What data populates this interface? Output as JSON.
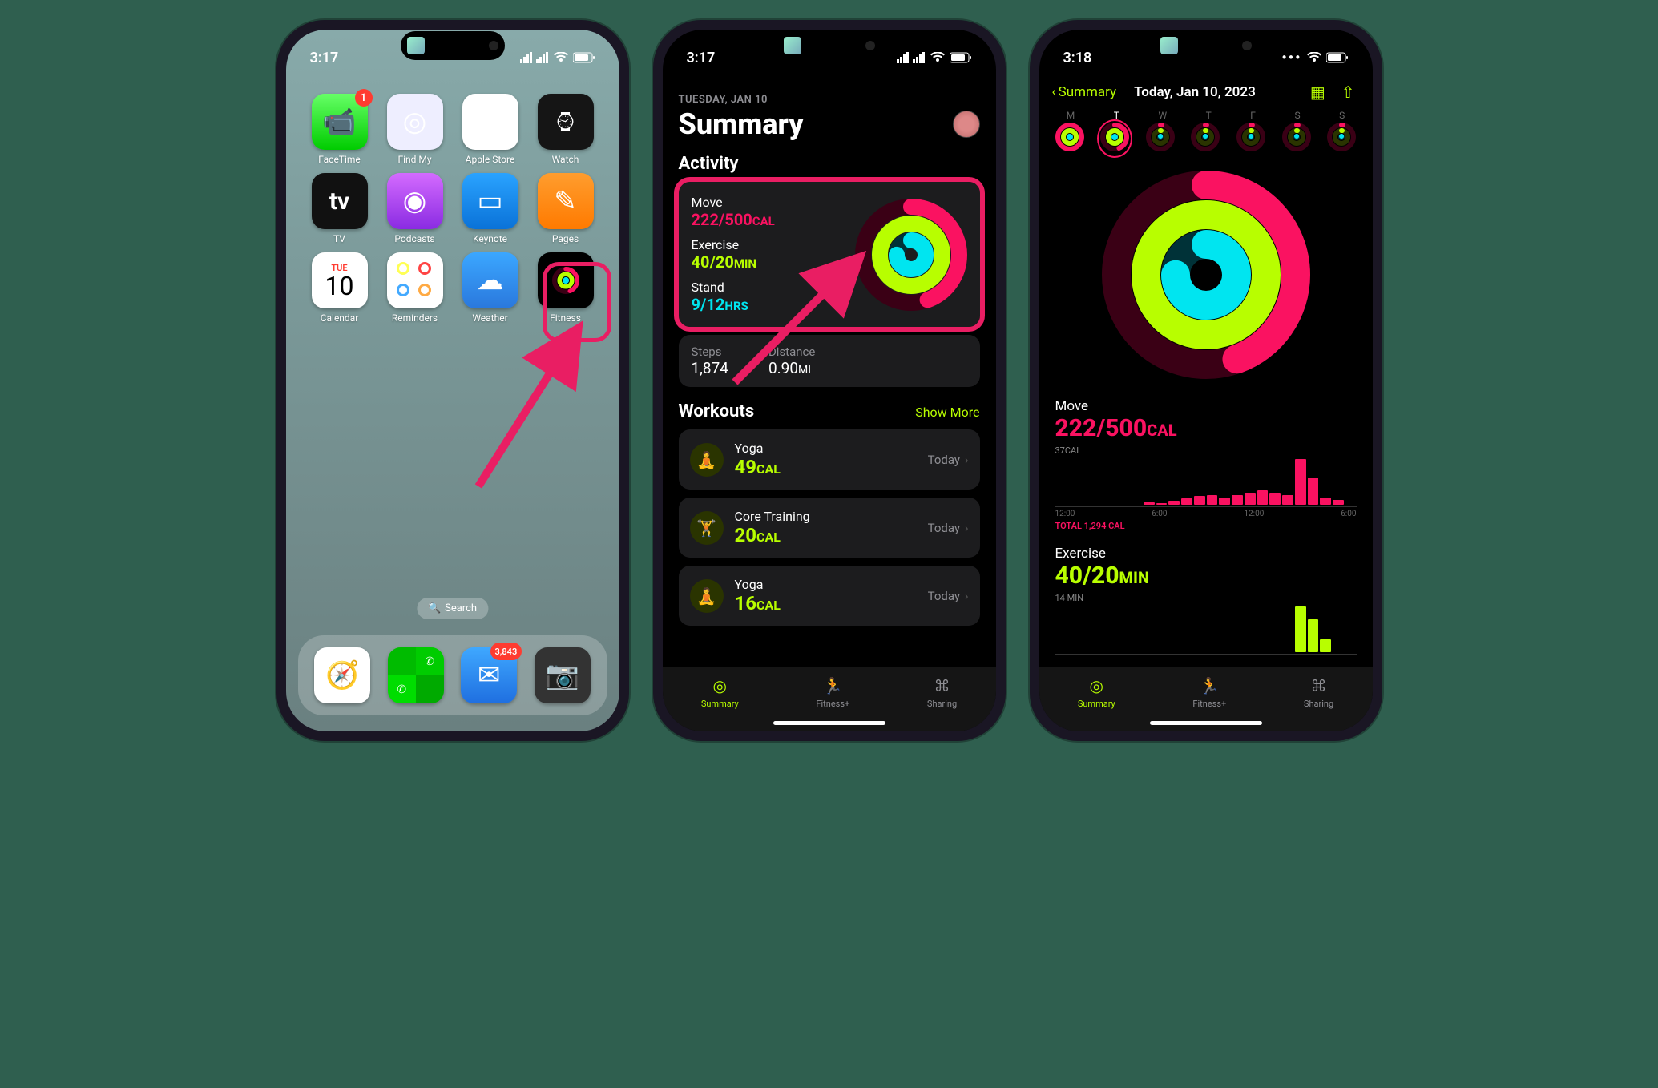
{
  "phone1": {
    "time": "3:17",
    "apps": [
      {
        "name": "FaceTime",
        "badge": "1",
        "bg": "linear-gradient(180deg,#6f6,#0c0)",
        "glyph": "📹"
      },
      {
        "name": "Find My",
        "bg": "#eef",
        "glyph": "◎"
      },
      {
        "name": "Apple Store",
        "bg": "#fff",
        "glyph": "🛍"
      },
      {
        "name": "Watch",
        "bg": "#151515",
        "glyph": "⌚︎"
      },
      {
        "name": "TV",
        "bg": "#111",
        "glyph": "tv"
      },
      {
        "name": "Podcasts",
        "bg": "linear-gradient(180deg,#d46bff,#8a2be2)",
        "glyph": "◉"
      },
      {
        "name": "Keynote",
        "bg": "linear-gradient(180deg,#2aa3ff,#0a72d8)",
        "glyph": "▭"
      },
      {
        "name": "Pages",
        "bg": "linear-gradient(180deg,#ff9d2e,#ff7a00)",
        "glyph": "✎"
      },
      {
        "name": "Calendar",
        "bg": "#fff",
        "glyph": "cal"
      },
      {
        "name": "Reminders",
        "bg": "#fff",
        "glyph": "rem"
      },
      {
        "name": "Weather",
        "bg": "linear-gradient(180deg,#3ba7ff,#2a78dd)",
        "glyph": "☁"
      },
      {
        "name": "Fitness",
        "bg": "#000",
        "glyph": "ring"
      }
    ],
    "cal_day": "TUE",
    "cal_num": "10",
    "search": "Search",
    "dock": [
      {
        "name": "Safari",
        "bg": "#fff",
        "glyph": "🧭"
      },
      {
        "name": "Messages",
        "bg": "#3c3",
        "glyph": "msg"
      },
      {
        "name": "Mail",
        "badge": "3,843",
        "bg": "linear-gradient(180deg,#3fa8ff,#1f6fe0)",
        "glyph": "✉︎"
      },
      {
        "name": "Camera",
        "bg": "#333",
        "glyph": "📷"
      }
    ]
  },
  "phone2": {
    "time": "3:17",
    "date": "TUESDAY, JAN 10",
    "title": "Summary",
    "activity_h": "Activity",
    "move_l": "Move",
    "move_v": "222/500",
    "move_u": "CAL",
    "ex_l": "Exercise",
    "ex_v": "40/20",
    "ex_u": "MIN",
    "st_l": "Stand",
    "st_v": "9/12",
    "st_u": "HRS",
    "steps_l": "Steps",
    "steps_v": "1,874",
    "dist_l": "Distance",
    "dist_v": "0.90",
    "dist_u": "MI",
    "workouts_h": "Workouts",
    "show_more": "Show More",
    "wk": [
      {
        "name": "Yoga",
        "cal": "49",
        "when": "Today"
      },
      {
        "name": "Core Training",
        "cal": "20",
        "when": "Today"
      },
      {
        "name": "Yoga",
        "cal": "16",
        "when": "Today"
      }
    ],
    "cal_u": "CAL",
    "tabs": {
      "summary": "Summary",
      "fitplus": "Fitness+",
      "sharing": "Sharing"
    }
  },
  "phone3": {
    "time": "3:18",
    "back": "Summary",
    "title": "Today, Jan 10, 2023",
    "days": [
      "M",
      "T",
      "W",
      "T",
      "F",
      "S",
      "S"
    ],
    "move_l": "Move",
    "move_v": "222/500",
    "move_u": "CAL",
    "move_peak": "37CAL",
    "move_axis": [
      "12:00",
      "6:00",
      "12:00",
      "6:00"
    ],
    "move_total": "TOTAL 1,294 CAL",
    "ex_l": "Exercise",
    "ex_v": "40/20",
    "ex_u": "MIN",
    "ex_peak": "14 MIN",
    "tabs": {
      "summary": "Summary",
      "fitplus": "Fitness+",
      "sharing": "Sharing"
    }
  },
  "chart_data": [
    {
      "type": "ring",
      "series": [
        {
          "name": "Move",
          "value": 222,
          "goal": 500,
          "color": "#fa1261"
        },
        {
          "name": "Exercise",
          "value": 40,
          "goal": 20,
          "color": "#b8fe00"
        },
        {
          "name": "Stand",
          "value": 9,
          "goal": 12,
          "color": "#00e5f0"
        }
      ]
    },
    {
      "type": "bar",
      "title": "Move hourly",
      "ylabel": "CAL",
      "peak": 37,
      "total": 1294,
      "categories": [
        "12:00",
        "",
        "",
        "",
        "",
        "",
        "6:00",
        "",
        "",
        "",
        "",
        "",
        "12:00",
        "",
        "",
        "",
        "",
        "",
        "6:00",
        "",
        "",
        "",
        "",
        ""
      ],
      "values": [
        0,
        0,
        0,
        0,
        0,
        0,
        0,
        2,
        1,
        3,
        5,
        7,
        8,
        6,
        8,
        10,
        12,
        10,
        8,
        37,
        22,
        6,
        4,
        0
      ]
    },
    {
      "type": "bar",
      "title": "Exercise hourly",
      "ylabel": "MIN",
      "peak": 14,
      "categories": [
        "12:00",
        "",
        "",
        "",
        "",
        "",
        "6:00",
        "",
        "",
        "",
        "",
        "",
        "12:00",
        "",
        "",
        "",
        "",
        "",
        "6:00",
        "",
        "",
        "",
        "",
        ""
      ],
      "values": [
        0,
        0,
        0,
        0,
        0,
        0,
        0,
        0,
        0,
        0,
        0,
        0,
        0,
        0,
        0,
        0,
        0,
        0,
        0,
        14,
        10,
        4,
        0,
        0
      ]
    }
  ]
}
